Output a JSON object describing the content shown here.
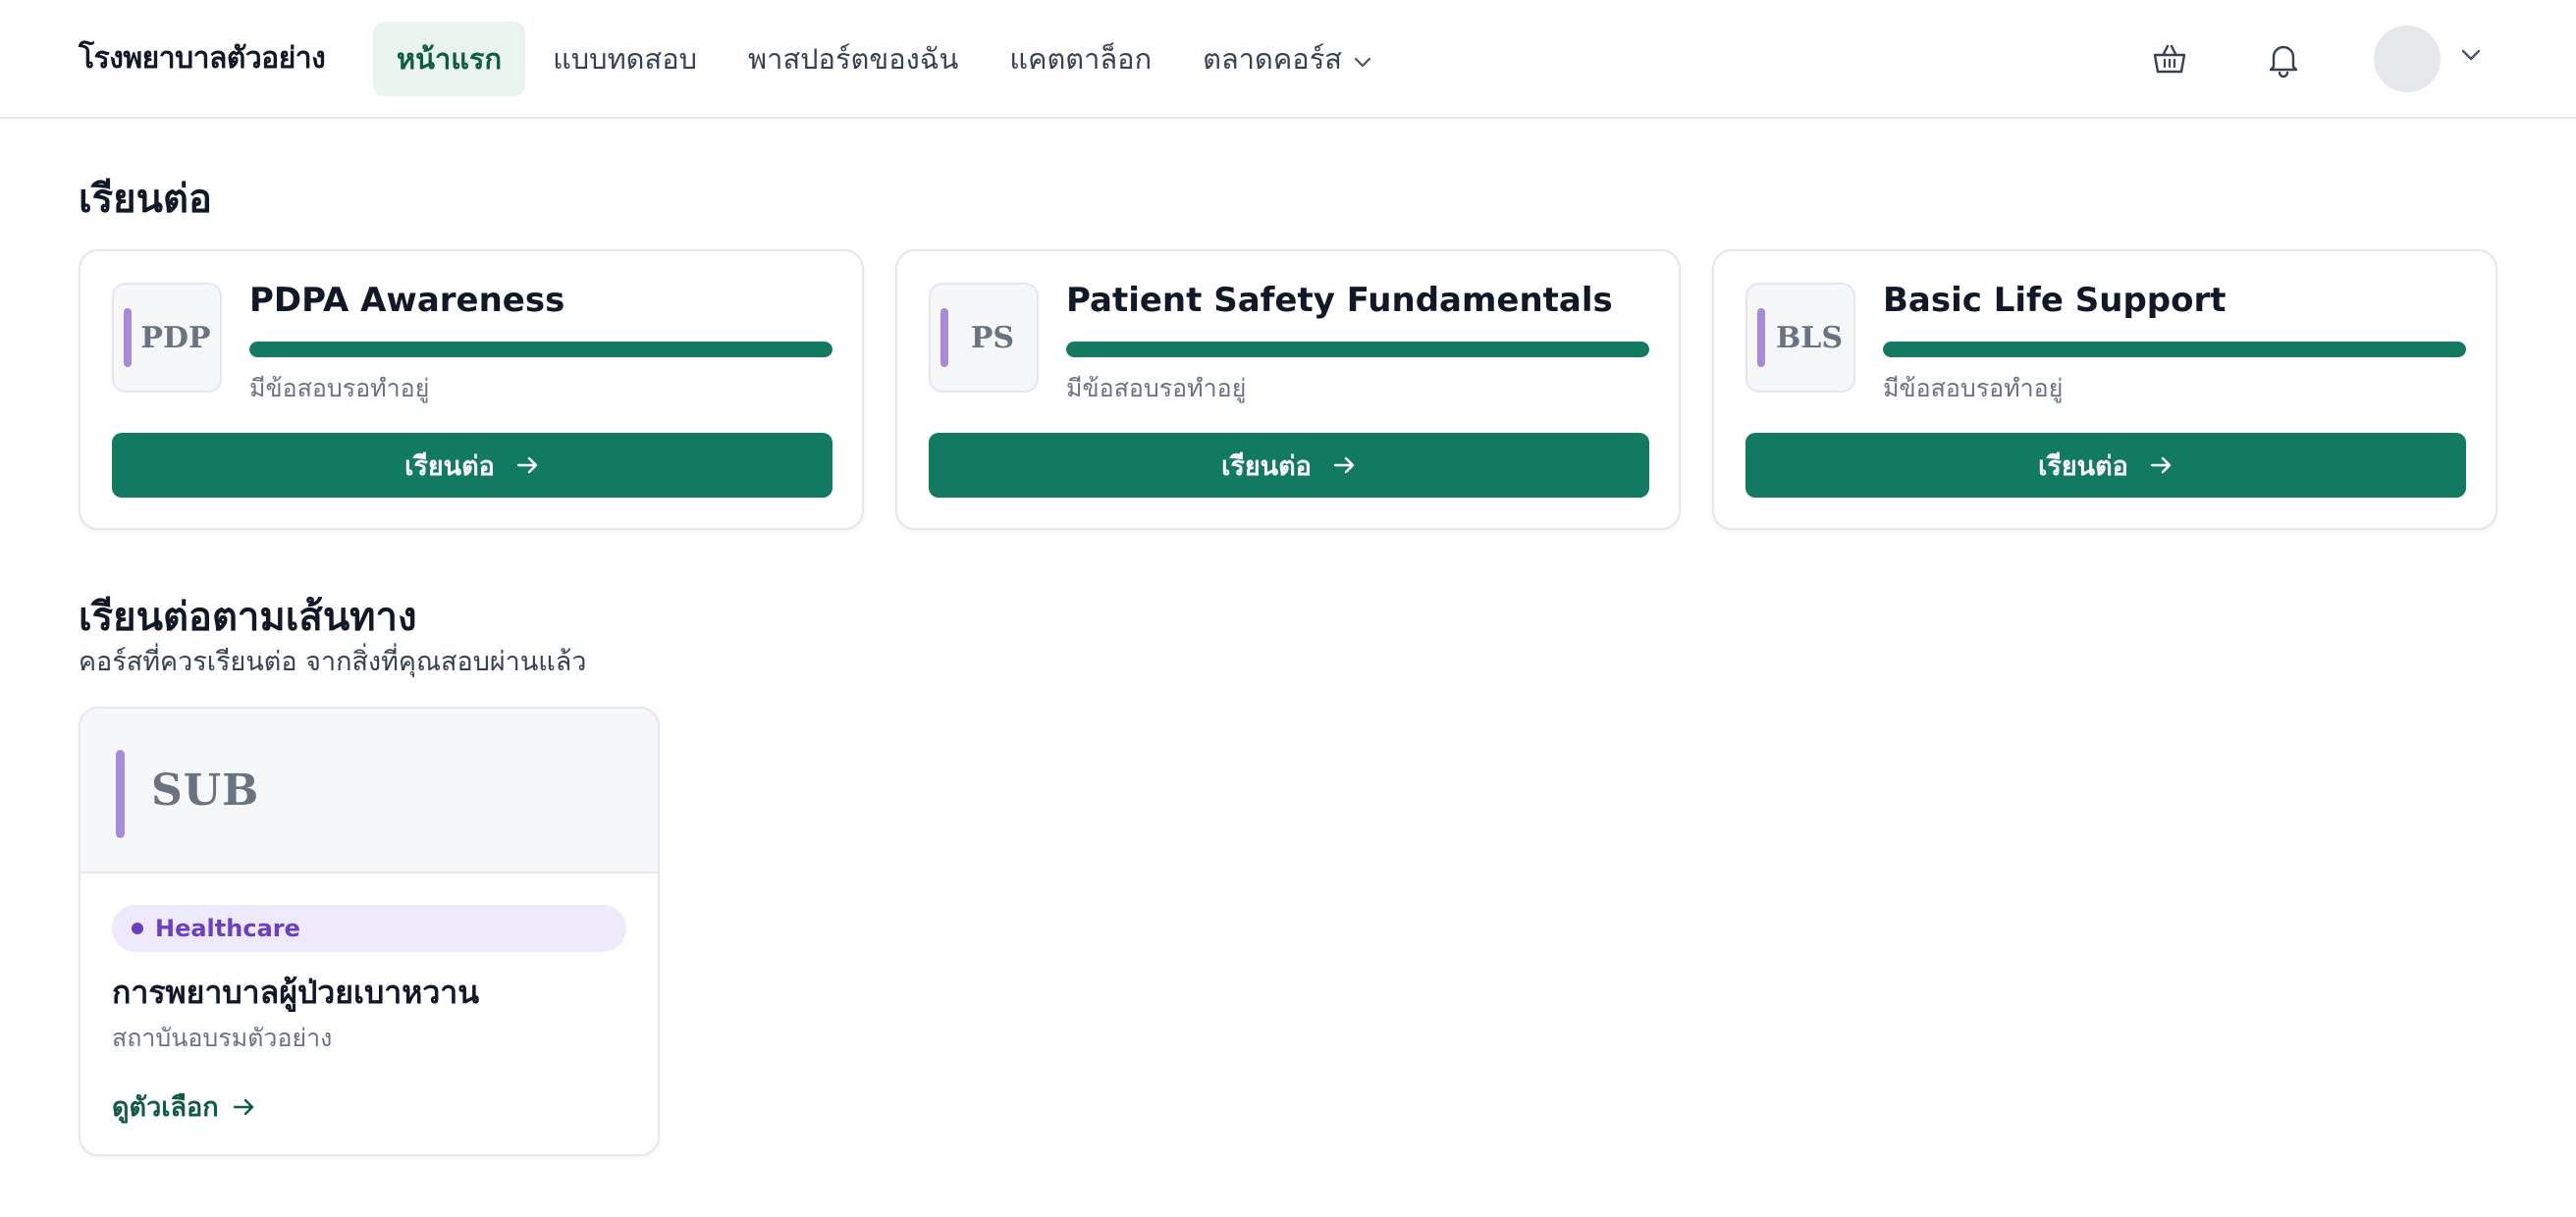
{
  "header": {
    "brand": "โรงพยาบาลตัวอย่าง",
    "nav": [
      {
        "label": "หน้าแรก",
        "active": true
      },
      {
        "label": "แบบทดสอบ",
        "active": false
      },
      {
        "label": "พาสปอร์ตของฉัน",
        "active": false
      },
      {
        "label": "แคตตาล็อก",
        "active": false
      },
      {
        "label": "ตลาดคอร์ส",
        "active": false,
        "dropdown": true
      }
    ],
    "icons": [
      "basket-icon",
      "bell-icon",
      "avatar",
      "chevron-down-icon"
    ]
  },
  "continue_section": {
    "title": "เรียนต่อ",
    "cards": [
      {
        "thumb": "PDP",
        "title": "PDPA Awareness",
        "progress": 1.0,
        "status": "มีข้อสอบรอทำอยู่",
        "button": "เรียนต่อ"
      },
      {
        "thumb": "PS",
        "title": "Patient Safety Fundamentals",
        "progress": 1.0,
        "status": "มีข้อสอบรอทำอยู่",
        "button": "เรียนต่อ"
      },
      {
        "thumb": "BLS",
        "title": "Basic Life Support",
        "progress": 1.0,
        "status": "มีข้อสอบรอทำอยู่",
        "button": "เรียนต่อ"
      }
    ]
  },
  "path_section": {
    "title": "เรียนต่อตามเส้นทาง",
    "subtitle": "คอร์สที่ควรเรียนต่อ จากสิ่งที่คุณสอบผ่านแล้ว",
    "card": {
      "thumb": "SUB",
      "tag": "Healthcare",
      "title": "การพยาบาลผู้ป่วยเบาหวาน",
      "org": "สถาบันอบรมตัวอย่าง",
      "link": "ดูตัวเลือก"
    }
  },
  "colors": {
    "primary": "#117a60",
    "accent_purple": "#a78bdc",
    "tag_text": "#6a3fc1",
    "tag_bg": "#efeafb",
    "nav_active_bg": "#e9f4ef"
  }
}
